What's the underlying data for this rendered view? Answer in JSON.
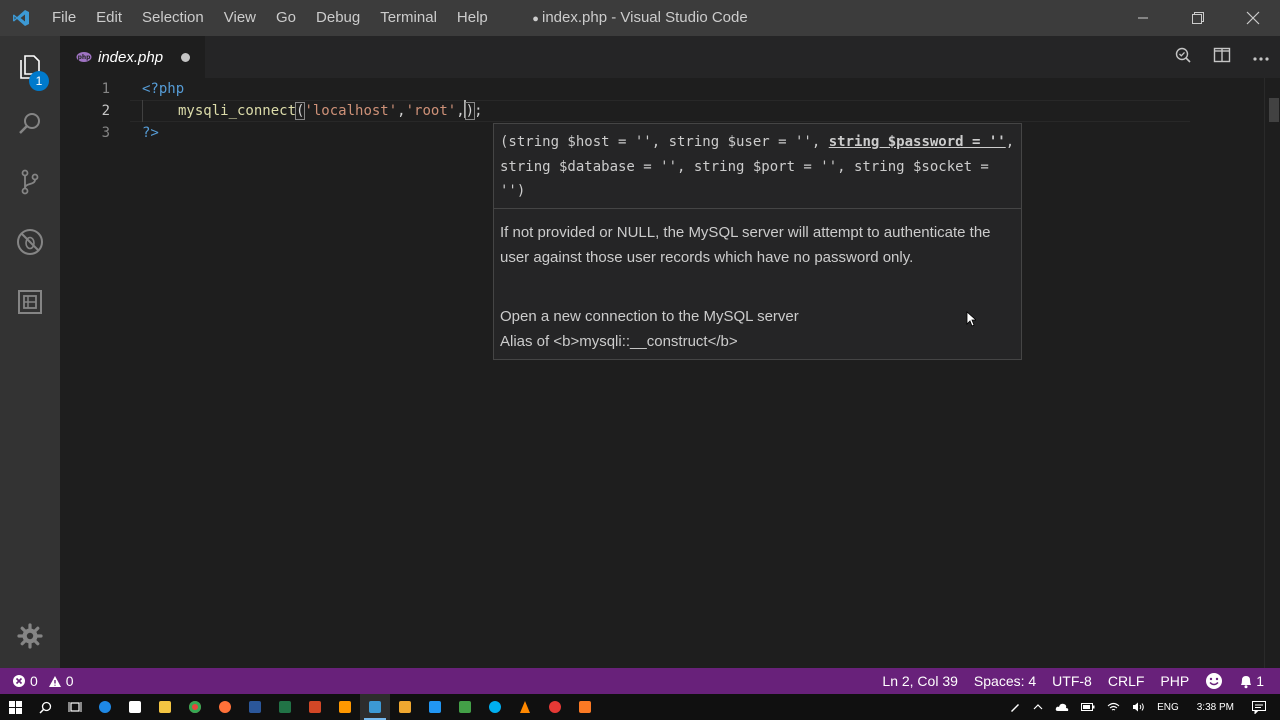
{
  "window": {
    "title": "index.php - Visual Studio Code"
  },
  "menu": [
    "File",
    "Edit",
    "Selection",
    "View",
    "Go",
    "Debug",
    "Terminal",
    "Help"
  ],
  "activity": {
    "explorer_badge": "1"
  },
  "tab": {
    "label": "index.php"
  },
  "editor": {
    "line_numbers": [
      "1",
      "2",
      "3"
    ],
    "line1": "<?php",
    "line2": {
      "fn": "mysqli_connect",
      "open": "(",
      "arg1": "'localhost'",
      "comma1": ",",
      "arg2": "'root'",
      "comma2": ",",
      "close": ")",
      "semi": ";"
    },
    "line3": "?>"
  },
  "hover": {
    "signature_before": "(string $host = '', string $user = '', ",
    "signature_active": "string $password = ''",
    "signature_after": ", string $database = '', string $port = '', string $socket = '')",
    "param_doc": "If not provided or NULL, the MySQL server will attempt to authenticate the user against those user records which have no password only.",
    "summary": "Open a new connection to the MySQL server",
    "alias": "Alias of <b>mysqli::__construct</b>"
  },
  "status": {
    "errors": "0",
    "warnings": "0",
    "position": "Ln 2, Col 39",
    "spaces": "Spaces: 4",
    "encoding": "UTF-8",
    "eol": "CRLF",
    "language": "PHP",
    "notifications": "1"
  },
  "taskbar": {
    "lang": "ENG",
    "time": "3:38 PM"
  },
  "colors": {
    "statusbar": "#68217a",
    "activitybar": "#333333",
    "editor_bg": "#1e1e1e",
    "accent": "#007acc"
  }
}
